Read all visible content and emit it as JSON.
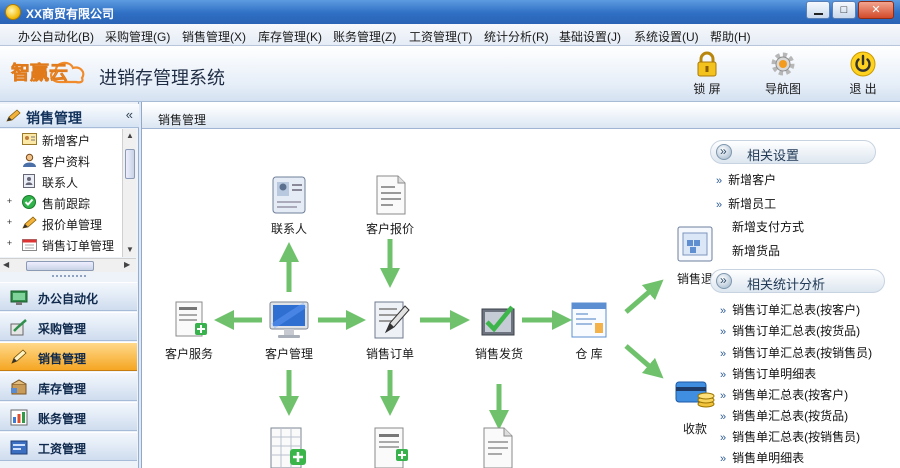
{
  "window": {
    "title": "XX商贸有限公司",
    "minimize": "0",
    "restore": "□",
    "close": "✕"
  },
  "menu": [
    "办公自动化(B)",
    "采购管理(G)",
    "销售管理(X)",
    "库存管理(K)",
    "账务管理(Z)",
    "工资管理(T)",
    "统计分析(R)",
    "基础设置(J)",
    "系统设置(U)",
    "帮助(H)"
  ],
  "header": {
    "logo_text": "智赢云",
    "system_title": "进销存管理系统",
    "buttons": [
      {
        "label": "锁 屏",
        "icon": "lock-icon"
      },
      {
        "label": "导航图",
        "icon": "navigation-gear-icon"
      },
      {
        "label": "退 出",
        "icon": "power-icon"
      }
    ]
  },
  "sidebar": {
    "title": "销售管理",
    "collapse_glyph": "«",
    "tree": [
      {
        "label": "新增客户",
        "icon": "new-customer-icon",
        "expander": ""
      },
      {
        "label": "客户资料",
        "icon": "customer-info-icon",
        "expander": ""
      },
      {
        "label": "联系人",
        "icon": "contact-icon",
        "expander": ""
      },
      {
        "label": "售前跟踪",
        "icon": "presale-tracking-icon",
        "expander": "+"
      },
      {
        "label": "报价单管理",
        "icon": "quotation-icon",
        "expander": "+"
      },
      {
        "label": "销售订单管理",
        "icon": "sales-order-icon",
        "expander": "+"
      }
    ],
    "modules": [
      {
        "label": "办公自动化",
        "icon": "office-icon"
      },
      {
        "label": "采购管理",
        "icon": "purchase-icon"
      },
      {
        "label": "销售管理",
        "icon": "sales-icon",
        "active": true
      },
      {
        "label": "库存管理",
        "icon": "inventory-icon"
      },
      {
        "label": "账务管理",
        "icon": "accounting-icon"
      },
      {
        "label": "工资管理",
        "icon": "salary-icon"
      }
    ]
  },
  "main": {
    "tab_title": "销售管理",
    "nodes": {
      "contact": "联系人",
      "quote": "客户报价",
      "service": "客户服务",
      "customer": "客户管理",
      "order": "销售订单",
      "delivery": "销售发货",
      "warehouse": "仓 库",
      "sales_return": "销售退",
      "receipt": "收款"
    },
    "related_settings": {
      "title": "相关设置",
      "links": [
        "新增客户",
        "新增员工",
        "新增支付方式",
        "新增货品"
      ]
    },
    "related_stats": {
      "title": "相关统计分析",
      "links": [
        "销售订单汇总表(按客户)",
        "销售订单汇总表(按货品)",
        "销售订单汇总表(按销售员)",
        "销售订单明细表",
        "销售单汇总表(按客户)",
        "销售单汇总表(按货品)",
        "销售单汇总表(按销售员)",
        "销售单明细表"
      ]
    }
  }
}
